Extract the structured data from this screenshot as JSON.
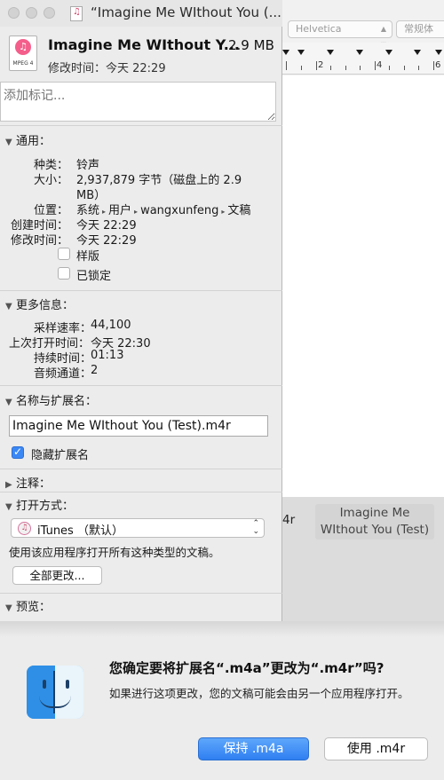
{
  "background_window": {
    "font_select": "Helvetica",
    "style_select": "常规体",
    "ruler_numbers": [
      "2",
      "4",
      "6"
    ],
    "file_icon_label": "Imagine Me WIthout You (Test)",
    "cut_label": "4r"
  },
  "info_window": {
    "title": "“Imagine Me WIthout You (...",
    "file": {
      "icon_label": "MPEG 4",
      "name": "Imagine Me WIthout Y...",
      "size": "2.9 MB",
      "modified": "修改时间：今天 22:29"
    },
    "tags_placeholder": "添加标记...",
    "general": {
      "header": "通用：",
      "kind_label": "种类：",
      "kind_value": "铃声",
      "size_label": "大小：",
      "size_value_line1": "2,937,879 字节（磁盘上的 2.9",
      "size_value_line2": "MB）",
      "where_label": "位置：",
      "path": [
        "系统",
        "用户",
        "wangxunfeng",
        "文稿"
      ],
      "created_label": "创建时间：",
      "created_value": "今天 22:29",
      "modified_label": "修改时间：",
      "modified_value": "今天 22:29",
      "stationery_label": "样版",
      "locked_label": "已锁定"
    },
    "more_info": {
      "header": "更多信息：",
      "sample_rate_label": "采样速率：",
      "sample_rate_value": "44,100",
      "last_opened_label": "上次打开时间：",
      "last_opened_value": "今天 22:30",
      "duration_label": "持续时间：",
      "duration_value": "01:13",
      "channels_label": "音频通道：",
      "channels_value": "2"
    },
    "name_ext": {
      "header": "名称与扩展名：",
      "value": "Imagine Me WIthout You (Test).m4r",
      "hide_ext_label": "隐藏扩展名"
    },
    "comments_header": "注释：",
    "open_with": {
      "header": "打开方式：",
      "app": "iTunes （默认）",
      "description": "使用该应用程序打开所有这种类型的文稿。",
      "change_all_label": "全部更改..."
    },
    "preview_header": "预览："
  },
  "alert": {
    "title": "您确定要将扩展名“.m4a”更改为“.m4r”吗?",
    "message": "如果进行这项更改，您的文稿可能会由另一个应用程序打开。",
    "keep_label": "保持 .m4a",
    "use_label": "使用 .m4r"
  }
}
